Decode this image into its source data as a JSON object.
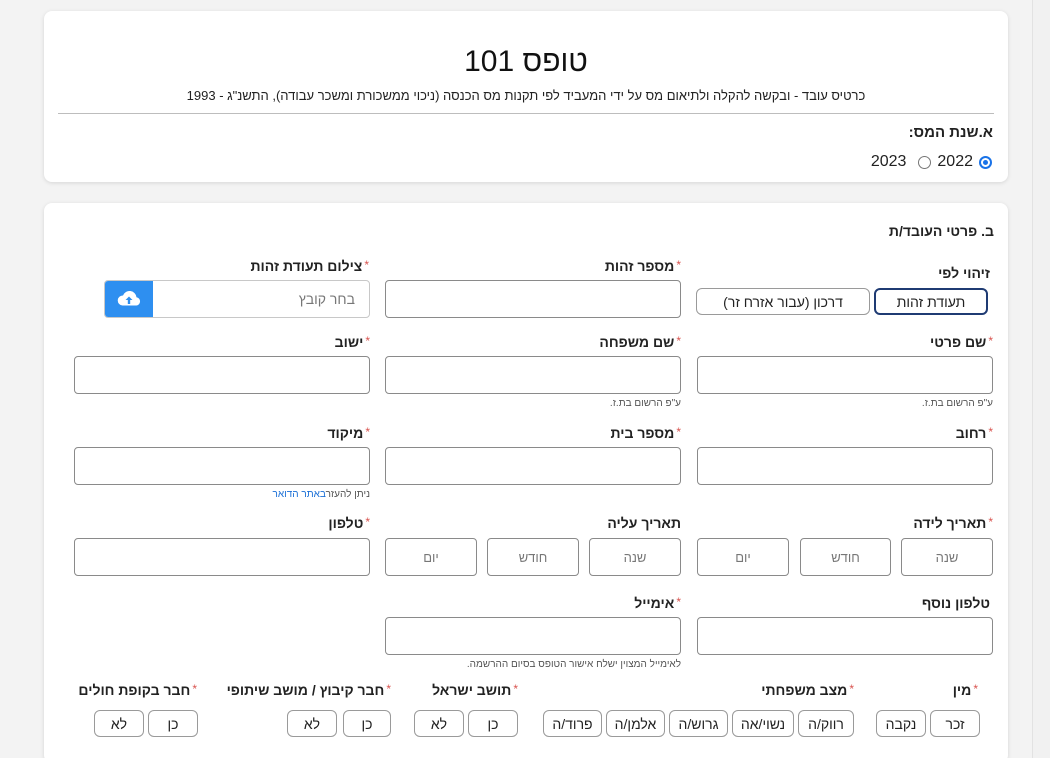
{
  "header": {
    "title": "טופס 101",
    "subtitle": "כרטיס עובד - ובקשה להקלה ולתיאום מס על ידי המעביד לפי תקנות מס הכנסה (ניכוי ממשכורת ומשכר עבודה), התשנ\"ג - 1993",
    "tax_year_label": "א.שנת המס:",
    "years": [
      {
        "label": "2022",
        "checked": true
      },
      {
        "label": "2023",
        "checked": false
      }
    ]
  },
  "form": {
    "section_title": "ב. פרטי העובד/ת",
    "id_by_label": "זיהוי לפי",
    "id_by_options": [
      "תעודת זהות",
      "דרכון (עבור אזרח זר)"
    ],
    "id_number_label": "מספר זהות",
    "id_photo_label": "צילום תעודת זהות",
    "file_placeholder": "בחר קובץ",
    "first_name_label": "שם פרטי",
    "last_name_label": "שם משפחה",
    "city_label": "ישוב",
    "per_id_hint": "ע\"פ הרשום בת.ז.",
    "street_label": "רחוב",
    "house_number_label": "מספר בית",
    "zip_label": "מיקוד",
    "zip_hint_prefix": "ניתן להעזר",
    "zip_hint_link": "באתר הדואר",
    "birth_date_label": "תאריך לידה",
    "aliyah_date_label": "תאריך עליה",
    "phone_label": "טלפון",
    "date_placeholders": {
      "year": "שנה",
      "month": "חודש",
      "day": "יום"
    },
    "extra_phone_label": "טלפון נוסף",
    "email_label": "אימייל",
    "email_hint": "לאימייל המצוין ישלח אישור הטופס בסיום ההרשמה.",
    "gender_label": "מין",
    "gender_options": [
      "זכר",
      "נקבה"
    ],
    "marital_label": "מצב משפחתי",
    "marital_options": [
      "רווק/ה",
      "נשוי/אה",
      "גרוש/ה",
      "אלמן/ה",
      "פרוד/ה"
    ],
    "resident_label": "תושב ישראל",
    "kibbutz_label": "חבר קיבוץ / מושב שיתופי",
    "hmo_label": "חבר בקופת חולים",
    "yes": "כן",
    "no": "לא"
  },
  "colors": {
    "accent": "#2e8ff0",
    "required": "#d9534f",
    "selected_border": "#1f3b73"
  }
}
